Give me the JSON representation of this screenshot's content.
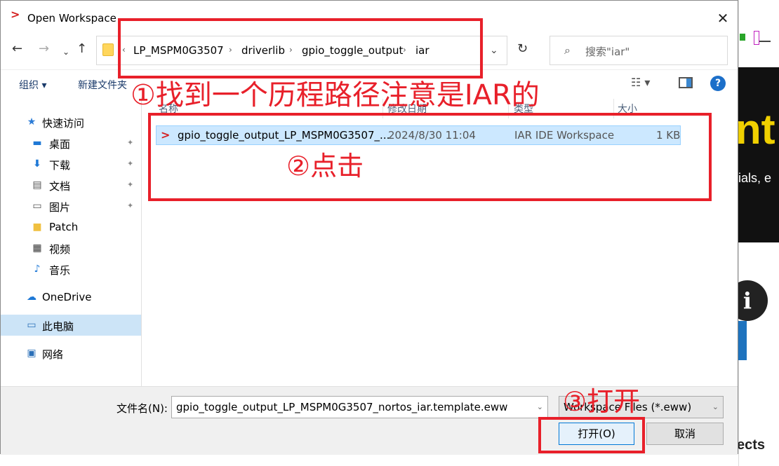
{
  "dialog": {
    "title": "Open Workspace",
    "close_glyph": "✕"
  },
  "nav": {
    "back_glyph": "←",
    "forward_glyph": "→",
    "recent_glyph": "⌄",
    "up_glyph": "↑",
    "breadcrumb_lead": "‹",
    "breadcrumbs": [
      "LP_MSPM0G3507",
      "driverlib",
      "gpio_toggle_output",
      "iar"
    ],
    "breadcrumb_sep": "›",
    "address_dropdown_glyph": "⌄",
    "refresh_glyph": "↻",
    "search_placeholder": "搜索\"iar\""
  },
  "toolbar": {
    "organize": "组织 ▾",
    "new_folder": "新建文件夹",
    "view_glyph": "☷ ▾",
    "help_glyph": "?"
  },
  "sidebar": {
    "quick_access": "快速访问",
    "items": [
      {
        "label": "桌面",
        "pinned": true
      },
      {
        "label": "下载",
        "pinned": true
      },
      {
        "label": "文档",
        "pinned": true
      },
      {
        "label": "图片",
        "pinned": true
      },
      {
        "label": "Patch",
        "pinned": false
      },
      {
        "label": "视频",
        "pinned": false
      },
      {
        "label": "音乐",
        "pinned": false
      }
    ],
    "onedrive": "OneDrive",
    "this_pc": "此电脑",
    "network": "网络",
    "pin_glyph": "📌"
  },
  "filelist": {
    "columns": [
      "名称",
      "修改日期",
      "类型",
      "大小"
    ],
    "rows": [
      {
        "name": "gpio_toggle_output_LP_MSPM0G3507_...",
        "date": "2024/8/30 11:04",
        "type": "IAR IDE Workspace",
        "size": "1 KB"
      }
    ]
  },
  "bottom": {
    "filename_label": "文件名(N):",
    "filename_value": "gpio_toggle_output_LP_MSPM0G3507_nortos_iar.template.eww",
    "filetype_value": "Workspace Files (*.eww)",
    "open_button": "打开(O)",
    "cancel_button": "取消"
  },
  "annotations": {
    "step1": "①找到一个历程路径注意是IAR的",
    "step2": "②点击",
    "step3": "③打开",
    "color": "#e8202a"
  },
  "background": {
    "big_text": "nt",
    "small_text": "ials, e",
    "info_glyph": "i",
    "bottom_text": "ects"
  }
}
